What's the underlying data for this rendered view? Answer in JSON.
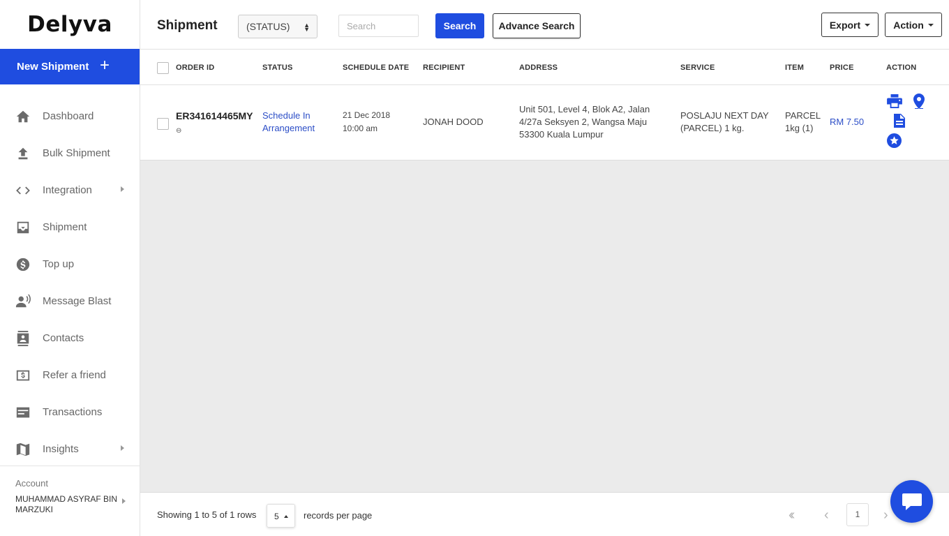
{
  "brand": {
    "logo_text": "Delyva"
  },
  "sidebar": {
    "new_shipment_label": "New Shipment",
    "new_shipment_plus": "+",
    "items": [
      {
        "label": "Dashboard",
        "icon": "home-icon"
      },
      {
        "label": "Bulk Shipment",
        "icon": "upload-icon"
      },
      {
        "label": "Integration",
        "icon": "code-icon",
        "has_submenu": true
      },
      {
        "label": "Shipment",
        "icon": "inbox-icon"
      },
      {
        "label": "Top up",
        "icon": "dollar-icon"
      },
      {
        "label": "Message Blast",
        "icon": "speaker-icon"
      },
      {
        "label": "Contacts",
        "icon": "contacts-icon"
      },
      {
        "label": "Refer a friend",
        "icon": "cash-icon"
      },
      {
        "label": "Transactions",
        "icon": "card-icon"
      },
      {
        "label": "Insights",
        "icon": "map-icon",
        "has_submenu": true
      }
    ],
    "account": {
      "label": "Account",
      "name": "MUHAMMAD ASYRAF BIN MARZUKI"
    }
  },
  "header": {
    "title": "Shipment",
    "status_select": "(STATUS)",
    "search_placeholder": "Search",
    "search_button": "Search",
    "advance_search_button": "Advance Search",
    "export_button": "Export",
    "action_button": "Action"
  },
  "table": {
    "columns": [
      "ORDER ID",
      "STATUS",
      "SCHEDULE DATE",
      "RECIPIENT",
      "ADDRESS",
      "SERVICE",
      "ITEM",
      "PRICE",
      "ACTION"
    ],
    "rows": [
      {
        "order_id": "ER341614465MY",
        "status": "Schedule In Arrangement",
        "schedule_date": "21 Dec 2018",
        "schedule_time": "10:00 am",
        "recipient": "JONAH DOOD",
        "address": "Unit 501, Level 4, Blok A2, Jalan 4/27a Seksyen 2, Wangsa Maju 53300 Kuala Lumpur",
        "service": "POSLAJU NEXT DAY (PARCEL) 1 kg.",
        "item": "PARCEL 1kg (1)",
        "price": "RM 7.50",
        "actions": [
          "print-icon",
          "location-icon",
          "document-icon",
          "star-icon"
        ]
      }
    ]
  },
  "footer": {
    "showing": "Showing 1 to 5 of 1 rows",
    "page_size": "5",
    "records_per_page": "records per page",
    "current_page": "1"
  },
  "colors": {
    "accent": "#1f4de0",
    "link": "#2c4ec7",
    "background": "#ebebeb"
  }
}
